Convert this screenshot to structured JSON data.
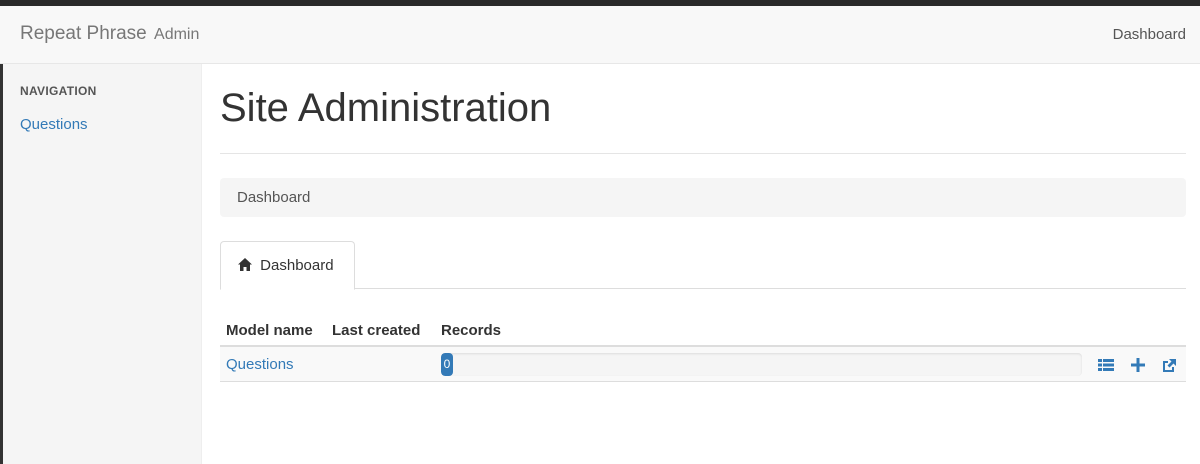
{
  "navbar": {
    "brand": "Repeat Phrase",
    "brand_suffix": "Admin",
    "right_link": "Dashboard"
  },
  "sidebar": {
    "header": "NAVIGATION",
    "items": [
      {
        "label": "Questions"
      }
    ]
  },
  "main": {
    "title": "Site Administration",
    "breadcrumb": "Dashboard",
    "tabs": [
      {
        "label": "Dashboard",
        "icon": "home-icon"
      }
    ],
    "table": {
      "headers": [
        "Model name",
        "Last created",
        "Records"
      ],
      "rows": [
        {
          "model": "Questions",
          "last_created": "",
          "records": "0",
          "progress": 0
        }
      ],
      "row_actions": [
        "list-icon",
        "plus-icon",
        "export-icon"
      ]
    }
  },
  "colors": {
    "link": "#337ab7",
    "progress": "#337ab7"
  }
}
